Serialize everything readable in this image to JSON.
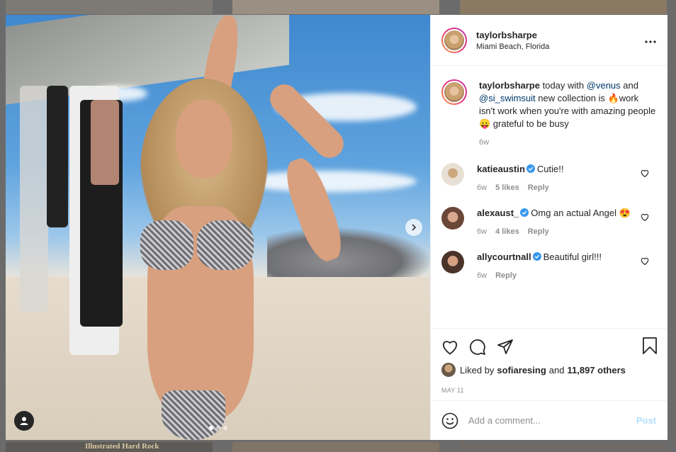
{
  "background": {
    "bottom_left_caption": "Illustrated  Hard Rock"
  },
  "post": {
    "author": {
      "username": "taylorbsharpe",
      "location": "Miami Beach, Florida"
    },
    "caption": {
      "username": "taylorbsharpe",
      "text_before_mention1": "today with ",
      "mention1": "@venus",
      "text_between": " and ",
      "mention2": "@si_swimsuit",
      "text_after": " new collection is 🔥work isn't work when you're with amazing people 😛 grateful to be busy",
      "time": "6w"
    },
    "comments": [
      {
        "username": "katieaustin",
        "verified": true,
        "text": "Cutie!!",
        "time": "6w",
        "likes": "5 likes",
        "reply_label": "Reply",
        "avatar_color": "#e8e0d4"
      },
      {
        "username": "alexaust_",
        "verified": true,
        "text": "Omg an actual Angel 😍",
        "time": "6w",
        "likes": "4 likes",
        "reply_label": "Reply",
        "avatar_color": "#b27e66"
      },
      {
        "username": "allycourtnall",
        "verified": true,
        "text": "Beautiful girl!!!",
        "time": "6w",
        "likes": "",
        "reply_label": "Reply",
        "avatar_color": "#6e5548"
      }
    ],
    "likes": {
      "prefix": "Liked by ",
      "user": "sofiaresing",
      "middle": " and ",
      "count": "11,897 others"
    },
    "date": "MAY 11",
    "add_comment": {
      "placeholder": "Add a comment...",
      "post_label": "Post"
    },
    "carousel": {
      "slide_count": 3,
      "active_slide": 1
    }
  },
  "colors": {
    "verified": "#3897f0",
    "mention": "#00376b",
    "post_button_disabled": "#b2dffc",
    "meta_text": "#8e8e8e"
  },
  "icons": [
    "more-icon",
    "heart-icon",
    "comment-icon",
    "share-icon",
    "bookmark-icon",
    "emoji-icon",
    "chevron-right-icon",
    "user-tag-icon",
    "verified-badge-icon"
  ]
}
